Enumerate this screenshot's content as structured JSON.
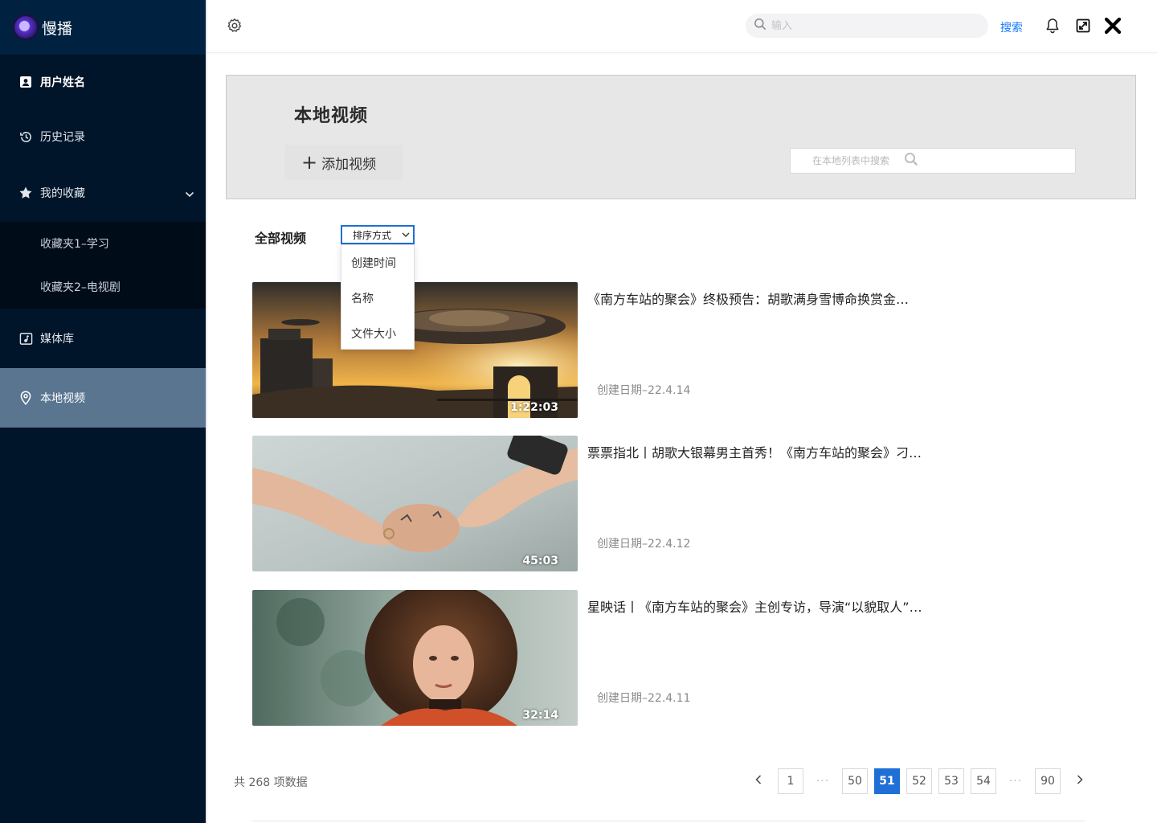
{
  "app": {
    "name": "慢播"
  },
  "sidebar": {
    "user_label": "用户姓名",
    "history_label": "历史记录",
    "favorites_label": "我的收藏",
    "favorites_folders": [
      "收藏夹1–学习",
      "收藏夹2–电视剧"
    ],
    "media_label": "媒体库",
    "local_label": "本地视频"
  },
  "header": {
    "search_placeholder": "输入",
    "search_button": "搜索"
  },
  "banner": {
    "title": "本地视频",
    "add_label": "添加视频",
    "local_search_placeholder": "在本地列表中搜索"
  },
  "filter": {
    "all_label": "全部视频",
    "sort_label": "排序方式",
    "sort_options": [
      "创建时间",
      "名称",
      "文件大小"
    ]
  },
  "videos": [
    {
      "title": "《南方车站的聚会》终极预告：胡歌满身雪博命换赏金…",
      "date": "创建日期–22.4.14",
      "duration": "1:22:03"
    },
    {
      "title": "票票指北丨胡歌大银幕男主首秀！《南方车站的聚会》刁…",
      "date": "创建日期–22.4.12",
      "duration": "45:03"
    },
    {
      "title": "星映话丨《南方车站的聚会》主创专访，导演“以貌取人”…",
      "date": "创建日期–22.4.11",
      "duration": "32:14"
    }
  ],
  "pagination": {
    "total": "共 268 项数据",
    "pages": [
      "1",
      "50",
      "51",
      "52",
      "53",
      "54",
      "90"
    ],
    "current": "51",
    "ellipsis": "···"
  },
  "colors": {
    "sidebar": "#001529",
    "sidebar_active": "#5a7590",
    "accent": "#1f6fd6",
    "link": "#1677ff"
  }
}
